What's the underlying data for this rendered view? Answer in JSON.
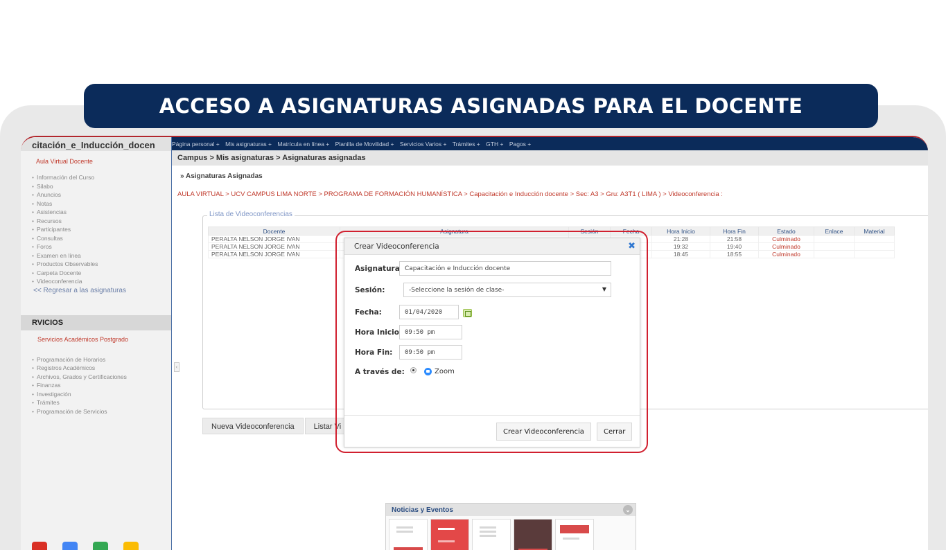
{
  "banner": {
    "title": "ACCESO A ASIGNATURAS ASIGNADAS PARA EL DOCENTE"
  },
  "sidebar": {
    "course_title": "citación_e_Inducción_docen",
    "subtitle": "Aula Virtual Docente",
    "items": [
      "Información del Curso",
      "Silabo",
      "Anuncios",
      "Notas",
      "Asistencias",
      "Recursos",
      "Participantes",
      "Consultas",
      "Foros",
      "Examen en línea",
      "Productos Observables",
      "Carpeta Docente",
      "Videoconferencia"
    ],
    "back_link": "<< Regresar a las asignaturas",
    "section_title": "RVICIOS",
    "section_subtitle": "Servicios Académicos Postgrado",
    "section_items": [
      "Programación de Horarios",
      "Registros Académicos",
      "Archivos, Grados y Certificaciones",
      "Finanzas",
      "Investigación",
      "Trámites",
      "Programación de Servicios"
    ]
  },
  "topmenu": {
    "items": [
      "Página personal +",
      "Mis asignaturas +",
      "Matrícula en línea +",
      "Planilla de Movilidad +",
      "Servicios Varios +",
      "Trámites +",
      "GTH +",
      "Pagos +"
    ]
  },
  "breadcrumb": "Campus > Mis asignaturas > Asignaturas asignadas",
  "main": {
    "section_heading": "» Asignaturas Asignadas",
    "path": "AULA VIRTUAL > UCV CAMPUS LIMA NORTE > PROGRAMA DE FORMACIÓN HUMANÍSTICA > Capacitación e Inducción docente > Sec: A3 > Gru: A3T1 ( LIMA ) > Videoconferencia :",
    "list_legend": "Lista de Videoconferencias",
    "table": {
      "headers": [
        "Docente",
        "Asignatura",
        "Sesión",
        "Fecha",
        "Hora Inicio",
        "Hora Fin",
        "Estado",
        "Enlace",
        "Material"
      ],
      "rows": [
        {
          "docente": "PERALTA NELSON JORGE IVAN",
          "hora_inicio": "21:28",
          "hora_fin": "21:58",
          "estado": "Culminado"
        },
        {
          "docente": "PERALTA NELSON JORGE IVAN",
          "hora_inicio": "19:32",
          "hora_fin": "19:40",
          "estado": "Culminado"
        },
        {
          "docente": "PERALTA NELSON JORGE IVAN",
          "hora_inicio": "18:45",
          "hora_fin": "18:55",
          "estado": "Culminado"
        }
      ]
    },
    "buttons": {
      "new": "Nueva Videoconferencia",
      "list": "Listar Vi"
    }
  },
  "news": {
    "title": "Noticias y Eventos"
  },
  "modal": {
    "title": "Crear Videoconferencia",
    "fields": {
      "asignatura_label": "Asignatura:",
      "asignatura_value": "Capacitación e Inducción docente",
      "sesion_label": "Sesión:",
      "sesion_value": "-Seleccione la sesión de clase-",
      "fecha_label": "Fecha:",
      "fecha_value": "01/04/2020",
      "hora_inicio_label": "Hora Inicio:",
      "hora_inicio_value": "09:50 pm",
      "hora_fin_label": "Hora Fin:",
      "hora_fin_value": "09:50 pm",
      "via_label": "A través de:",
      "via_option": "Zoom"
    },
    "buttons": {
      "create": "Crear Videoconferencia",
      "close": "Cerrar"
    }
  },
  "colors": {
    "navy": "#0b2b5a",
    "highlight": "#d1202f",
    "status_red": "#c0392b"
  },
  "icons": [
    "close-icon",
    "calendar-icon",
    "radio-icon",
    "zoom-icon",
    "chevron-down-icon",
    "gmail-icon",
    "docs-icon",
    "drive-icon",
    "keep-icon"
  ]
}
